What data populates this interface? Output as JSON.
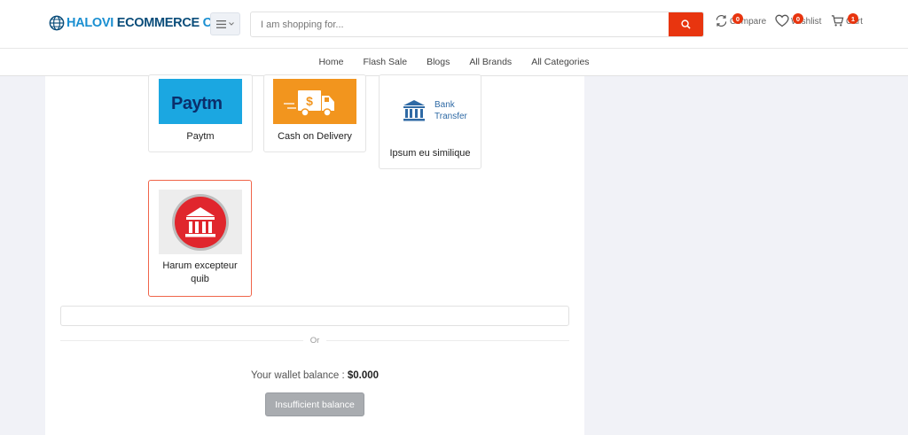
{
  "header": {
    "logo": {
      "part1": "HALOVI",
      "part2": "ECOMMERCE",
      "part3": "CMS"
    },
    "search": {
      "placeholder": "I am shopping for...",
      "value": ""
    },
    "compare": {
      "label": "Compare",
      "count": "0"
    },
    "wishlist": {
      "label": "Wishlist",
      "count": "0"
    },
    "cart": {
      "label": "Cart",
      "count": "1"
    }
  },
  "nav": {
    "items": [
      "Home",
      "Flash Sale",
      "Blogs",
      "All Brands",
      "All Categories"
    ]
  },
  "payment": {
    "options": [
      {
        "name": "Paytm",
        "logo_text": "Paytm"
      },
      {
        "name": "Cash on Delivery"
      },
      {
        "name": "Ipsum eu similique",
        "logo_line1": "Bank",
        "logo_line2": "Transfer"
      },
      {
        "name": "Harum excepteur quib",
        "selected": true
      }
    ],
    "field_value": "",
    "or_text": "Or",
    "wallet_label": "Your wallet balance :",
    "wallet_amount": "$0.000",
    "insufficient_button": "Insufficient balance"
  },
  "colors": {
    "accent": "#e8350f",
    "paytm_bg": "#1ba7e1",
    "cod_bg": "#f2951e",
    "bank_blue": "#2f6aa5",
    "harum_red": "#e0262d",
    "selected_border": "#f0654a"
  }
}
